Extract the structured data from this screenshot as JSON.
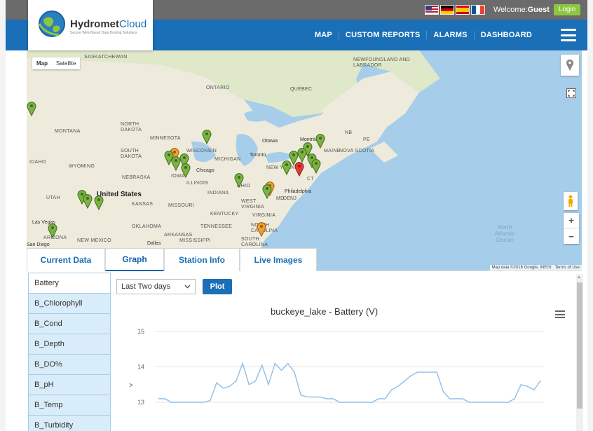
{
  "topbar": {
    "welcome_prefix": "Welcome:",
    "user": "Guest",
    "login_label": "Login"
  },
  "brand": {
    "name_main": "Hydromet",
    "name_accent": "Cloud",
    "tagline": "Secure Web-Based Data Hosting Solutions"
  },
  "nav": {
    "links": [
      "MAP",
      "CUSTOM REPORTS",
      "ALARMS",
      "DASHBOARD"
    ]
  },
  "map": {
    "type_buttons": [
      "Map",
      "Satellite"
    ],
    "labels": {
      "saskatchewan": "SASKATCHEWAN",
      "ontario": "ONTARIO",
      "quebec": "QUÉBEC",
      "newfoundland": "NEWFOUNDLAND AND LABRADOR",
      "montana": "MONTANA",
      "north_dakota": "NORTH DAKOTA",
      "minnesota": "MINNESOTA",
      "wisconsin": "WISCONSIN",
      "south_dakota": "SOUTH DAKOTA",
      "michigan": "MICHIGAN",
      "idaho": "IDAHO",
      "wyoming": "WYOMING",
      "nebraska": "NEBRASKA",
      "iowa": "IOWA",
      "illinois": "ILLINOIS",
      "indiana": "INDIANA",
      "ohio": "OHIO",
      "utah": "UTAH",
      "united_states": "United States",
      "kansas": "KANSAS",
      "missouri": "MISSOURI",
      "kentucky": "KENTUCKY",
      "virginia": "VIRGINIA",
      "west_virginia": "WEST VIRGINIA",
      "oklahoma": "OKLAHOMA",
      "tennessee": "TENNESSEE",
      "north_carolina": "NORTH CAROLINA",
      "arkansas": "ARKANSAS",
      "mississippi": "MISSISSIPPI",
      "south_carolina": "SOUTH CAROLINA",
      "arizona": "ARIZONA",
      "new_mexico": "NEW MEXICO",
      "nova_scotia": "NOVA SCOTIA",
      "nb": "NB",
      "pe": "PE",
      "maine": "MAINE",
      "new_york": "NEW YORK",
      "nj": "NJ",
      "de": "DE",
      "md": "MD",
      "ct": "CT",
      "ottawa": "Ottawa",
      "montreal": "Montréal",
      "toronto": "Toronto",
      "chicago": "Chicago",
      "philadelphia": "Philadelphia",
      "dallas": "Dallas",
      "las_vegas": "Las Vegas",
      "san_diego": "San Diego",
      "ocean": "North Atlantic Ocean"
    },
    "attribution": "Map data ©2016 Google, INEGI",
    "terms": "Terms of Use",
    "zoom_in": "+",
    "zoom_out": "−"
  },
  "tabs": [
    "Current Data",
    "Graph",
    "Station Info",
    "Live Images"
  ],
  "sidebar": {
    "items": [
      "Battery",
      "B_Chlorophyll",
      "B_Cond",
      "B_Depth",
      "B_DO%",
      "B_pH",
      "B_Temp",
      "B_Turbidity"
    ]
  },
  "controls": {
    "range_value": "Last Two days",
    "plot_label": "Plot"
  },
  "chart_data": {
    "type": "line",
    "title": "buckeye_lake - Battery (V)",
    "ylabel": ">",
    "yticks": [
      "15",
      "14",
      "13"
    ],
    "ylim": [
      12.8,
      15
    ],
    "grid": true,
    "series": [
      {
        "values": [
          13.1,
          13.1,
          13.0,
          13.0,
          13.0,
          13.0,
          13.0,
          13.0,
          13.05,
          13.55,
          13.4,
          13.45,
          13.6,
          14.1,
          13.5,
          13.6,
          14.05,
          13.5,
          14.1,
          13.9,
          14.1,
          13.85,
          13.2,
          13.15,
          13.15,
          13.15,
          13.1,
          13.1,
          13.0,
          13.0,
          13.0,
          13.0,
          13.0,
          13.0,
          13.1,
          13.1,
          13.35,
          13.45,
          13.6,
          13.75,
          13.85,
          13.85,
          13.85,
          13.85,
          13.3,
          13.1,
          13.1,
          13.1,
          13.0,
          13.0,
          13.0,
          13.0,
          13.0,
          13.0,
          13.0,
          13.1,
          13.5,
          13.45,
          13.35,
          13.6
        ]
      }
    ]
  }
}
